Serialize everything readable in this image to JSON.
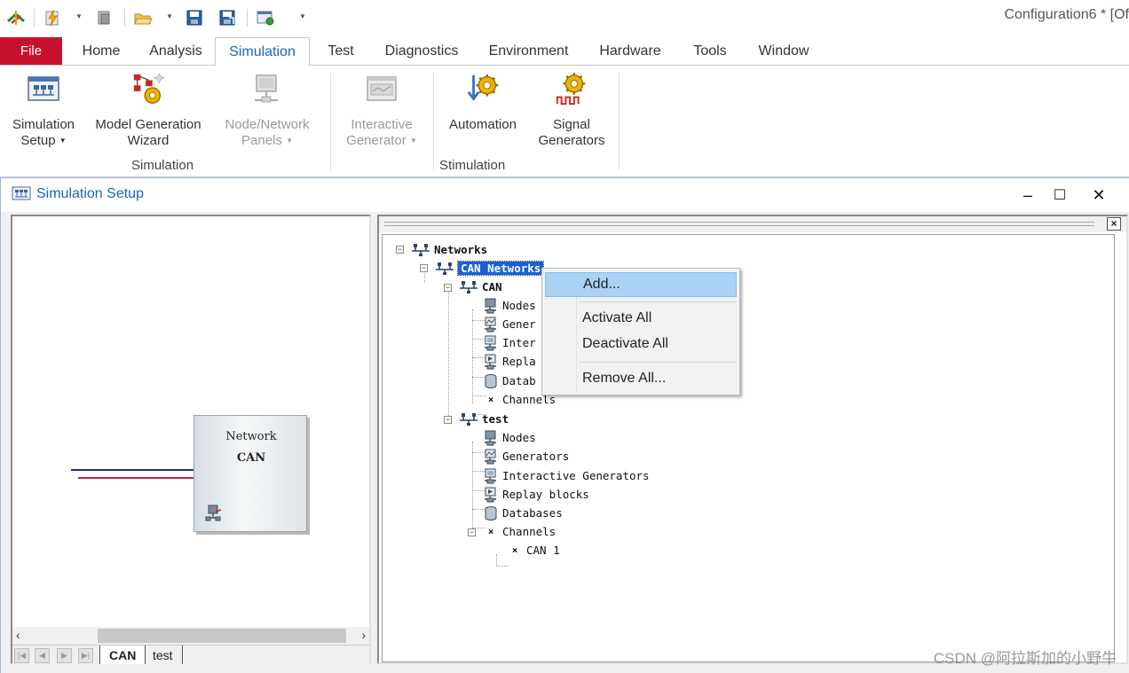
{
  "window_title": "Configuration6 * [Of",
  "quick_access": {
    "icons": [
      "app-logo-icon",
      "lightning-icon",
      "stop-icon",
      "open-folder-icon",
      "save-icon",
      "save-all-icon",
      "panel-icon",
      "customize-icon"
    ]
  },
  "tabs": [
    {
      "label": "File"
    },
    {
      "label": "Home"
    },
    {
      "label": "Analysis"
    },
    {
      "label": "Simulation"
    },
    {
      "label": "Test"
    },
    {
      "label": "Diagnostics"
    },
    {
      "label": "Environment"
    },
    {
      "label": "Hardware"
    },
    {
      "label": "Tools"
    },
    {
      "label": "Window"
    }
  ],
  "active_tab": "Simulation",
  "ribbon": {
    "groups": [
      {
        "label": "Simulation"
      },
      {
        "label": "Stimulation"
      }
    ],
    "buttons": [
      {
        "line1": "Simulation",
        "line2": "Setup"
      },
      {
        "line1": "Model Generation",
        "line2": "Wizard"
      },
      {
        "line1": "Node/Network",
        "line2": "Panels"
      },
      {
        "line1": "Interactive",
        "line2": "Generator"
      },
      {
        "line1": "Automation",
        "line2": ""
      },
      {
        "line1": "Signal",
        "line2": "Generators"
      }
    ]
  },
  "child_window": {
    "title": "Simulation Setup",
    "controls": {
      "minimize": "–",
      "maximize": "☐",
      "close": "✕"
    }
  },
  "left_pane": {
    "network_box": {
      "line1": "Network",
      "line2": "CAN"
    },
    "sheet_tabs": [
      "CAN",
      "test"
    ],
    "active_sheet": "CAN"
  },
  "tree": {
    "root": "Networks",
    "can_networks": "CAN Networks",
    "can": {
      "label": "CAN",
      "children": [
        "Nodes",
        "Gener",
        "Inter",
        "Repla",
        "Datab",
        "Channels"
      ]
    },
    "test": {
      "label": "test",
      "children": [
        "Nodes",
        "Generators",
        "Interactive Generators",
        "Replay blocks",
        "Databases",
        "Channels"
      ],
      "channel_children": [
        "CAN 1"
      ]
    }
  },
  "context_menu": {
    "items": [
      "Add...",
      "Activate All",
      "Deactivate All",
      "Remove All..."
    ]
  },
  "watermark": "CSDN @阿拉斯加的小野牛",
  "colors": {
    "file_tab": "#c8102e",
    "accent_blue": "#1a66b8",
    "selection": "#1a5fd6",
    "menu_highlight": "#a9d2f5"
  }
}
